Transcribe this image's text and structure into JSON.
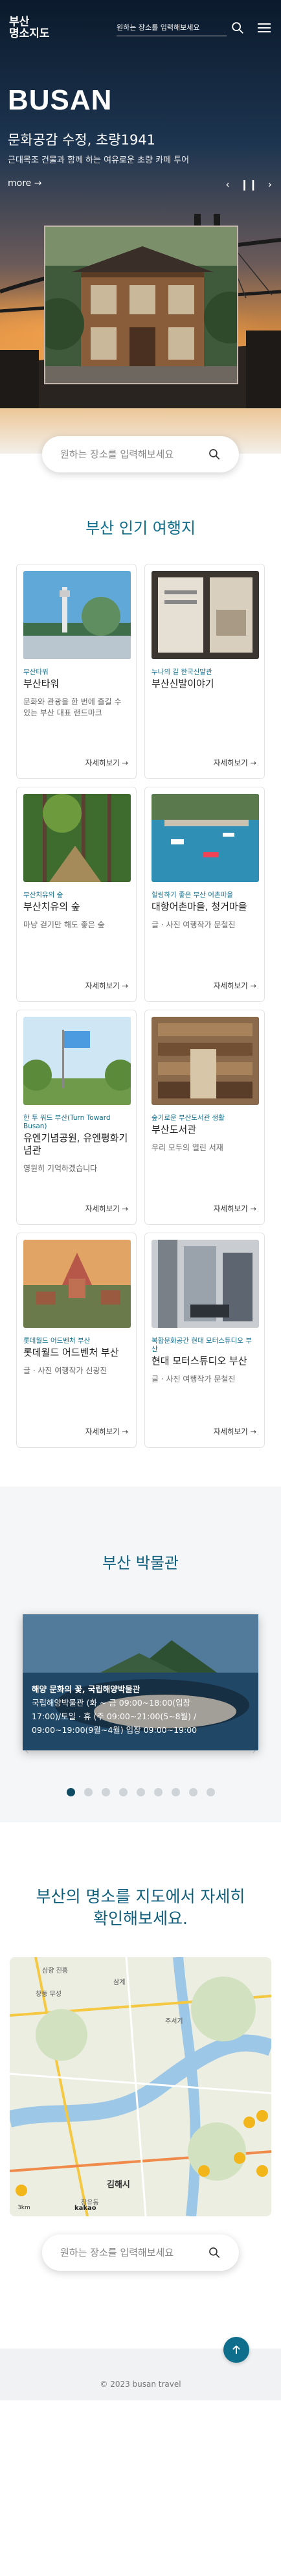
{
  "header": {
    "logo_line1": "부산",
    "logo_line2": "명소지도",
    "search_placeholder": "원하는 장소를 입력해보세요",
    "search_icon": "search-icon",
    "menu_icon": "hamburger-menu-icon"
  },
  "hero": {
    "city": "BUSAN",
    "title": "문화공감 수정, 초량1941",
    "subtitle": "근대목조 건물과 함께 하는 여유로운 초량 카페 투어",
    "more_label": "more",
    "more_arrow": "→",
    "prev_icon": "‹",
    "pause_icon": "❙❙",
    "next_icon": "›",
    "search_placeholder": "원하는 장소를 입력해보세요"
  },
  "popular": {
    "title": "부산 인기 여행지",
    "more_label": "자세히보기 →",
    "cards": [
      {
        "category": "부산타워",
        "title": "부산타워",
        "desc": "문화와 관광을 한 번에 즐길 수 있는 부산 대표 랜드마크"
      },
      {
        "category": "누나의 길 한국신발관",
        "title": "부산신발이야기",
        "desc": ""
      },
      {
        "category": "부산치유의 숲",
        "title": "부산치유의 숲",
        "desc": "마냥 걷기만 해도 좋은 숲"
      },
      {
        "category": "힐링하기 좋은 부산 어촌마을",
        "title": "대항어촌마을, 청거마을",
        "desc": "글 · 사진 여행작가 문철진"
      },
      {
        "category": "한 투 워드 부산(Turn Toward Busan)",
        "title": "유엔기념공원, 유엔평화기념관",
        "desc": "영원히 기억하겠습니다"
      },
      {
        "category": "숲기로운 부산도서관 생활",
        "title": "부산도서관",
        "desc": "우리 모두의 열린 서재"
      },
      {
        "category": "롯데월드 어드벤처 부산",
        "title": "롯데월드 어드벤처 부산",
        "desc": "글 · 사진 여행작가 신광진"
      },
      {
        "category": "복합문화공간 현대 모터스튜디오 부산",
        "title": "현대 모터스튜디오 부산",
        "desc": "글 · 사진 여행작가 문철진"
      }
    ]
  },
  "museum": {
    "title": "부산 박물관",
    "slide_line1": "해양 문화의 꽃, 국립해양박물관",
    "slide_line2": "국립해양박물관 (화 ~ 금 09:00~18:00(입장",
    "slide_line3": "17:00)/토일 · 휴 (주 09:00~21:00(5~8월) /",
    "slide_line4": "09:00~19:00(9월~4월) 입장 09:00~19:00",
    "prev_icon": "‹",
    "next_icon": "›",
    "dot_count": 9
  },
  "map": {
    "title_line1": "부산의 명소를 지도에서 자세히",
    "title_line2": "확인해보세요.",
    "search_placeholder": "원하는 장소를 입력해보세요",
    "label_a": "삼향 진흥",
    "label_b": "창동 무성",
    "label_c": "김해시",
    "label_d": "장유동",
    "label_e": "삼계",
    "label_f": "주서기",
    "label_g": "kakao",
    "label_h": "3km"
  },
  "footer": {
    "copyright": "© 2023 busan travel",
    "top_icon": "arrow-up-icon"
  },
  "colors": {
    "accent": "#0f6e8c",
    "footer_bg": "#f0f2f4"
  }
}
